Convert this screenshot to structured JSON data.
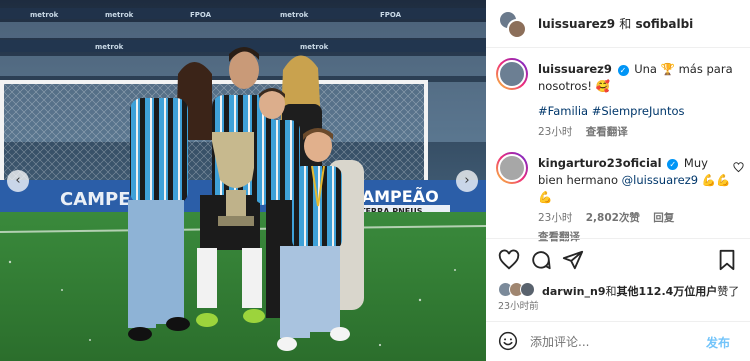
{
  "photo": {
    "alt": "Family celebrating with trophy on football pitch",
    "board_texts": [
      "metrok",
      "metrok",
      "metrok",
      "FPOA",
      "metrok",
      "metrok",
      "FPOA"
    ],
    "banner_text": "CAMPEÃO",
    "banner_sub": "TERRA PNEUS",
    "nav_prev": "‹",
    "nav_next": "›"
  },
  "header": {
    "user1": "luissuarez9",
    "conjunction": "和",
    "user2": "sofibalbi"
  },
  "caption": {
    "username": "luissuarez9",
    "text_before": "Una ",
    "trophy": "🏆",
    "text_after": " más para nosotros! ",
    "heart_face": "🥰",
    "hashtags": "#Familia #SiempreJuntos",
    "time": "23小时",
    "see_translation": "查看翻译"
  },
  "comment": {
    "username": "kingarturo23oficial",
    "text": "Muy bien hermano ",
    "mention": "@luissuarez9",
    "emojis": "💪💪💪",
    "time": "23小时",
    "likes": "2,802次赞",
    "reply": "回复",
    "see_translation": "查看翻译"
  },
  "likes": {
    "user": "darwin_n9",
    "connector": "和",
    "others": "其他112.4万位用户",
    "suffix": "赞了",
    "ago": "23小时前"
  },
  "composer": {
    "placeholder": "添加评论...",
    "post_label": "发布"
  },
  "colors": {
    "verified": "#0095f6",
    "link": "#00376b",
    "pitch": "#2f7a33",
    "jersey_blue": "#3fa1d8",
    "jersey_black": "#1b1b1b"
  },
  "icons": [
    "heart-icon",
    "comment-icon",
    "share-icon",
    "bookmark-icon",
    "emoji-icon",
    "verified-icon"
  ]
}
